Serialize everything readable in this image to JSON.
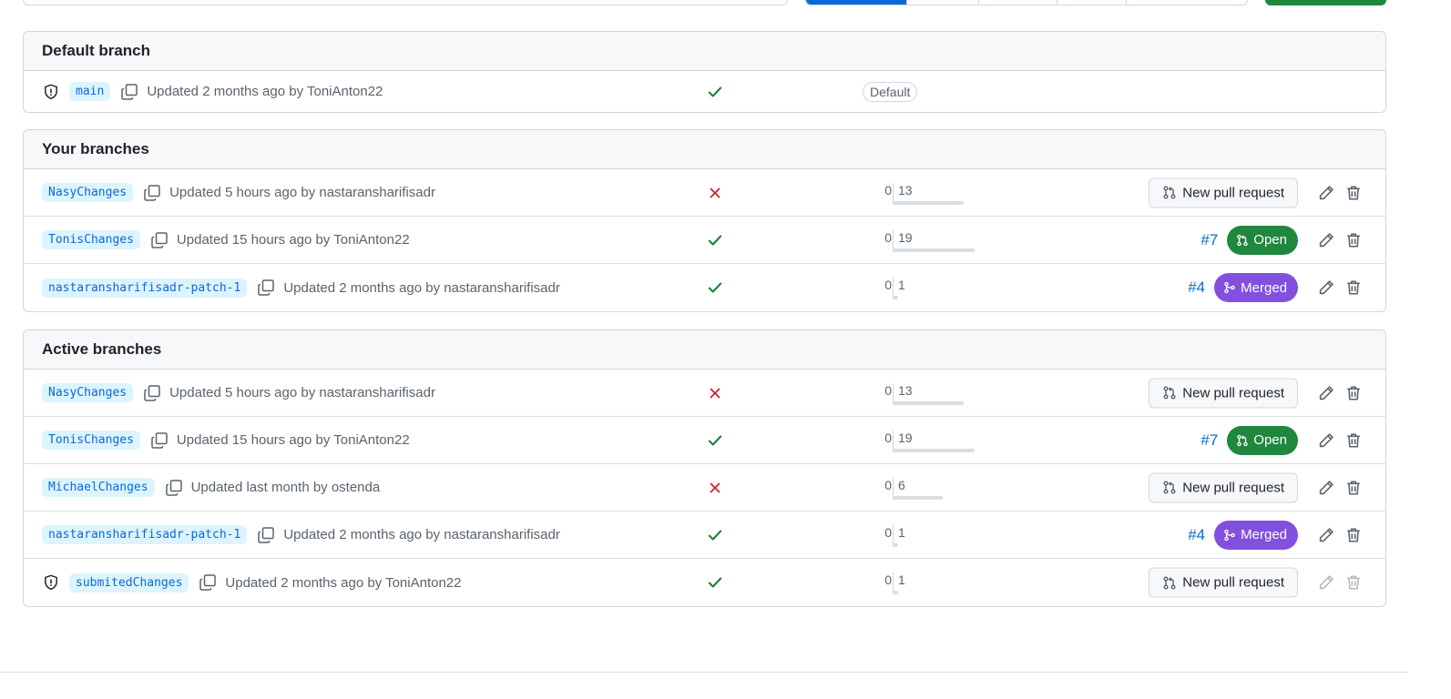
{
  "colors": {
    "success": "#1a7f37",
    "danger": "#cf222e",
    "link": "#0969da",
    "open": "#1f883d",
    "merged": "#8250df"
  },
  "default_section": {
    "title": "Default branch",
    "rows": [
      {
        "name": "main",
        "protected": true,
        "updated": "Updated 2 months ago by ToniAnton22",
        "status": "success",
        "badge": "Default"
      }
    ]
  },
  "your_section": {
    "title": "Your branches",
    "rows": [
      {
        "name": "NasyChanges",
        "updated": "Updated 5 hours ago by nastaransharifisadr",
        "status": "failure",
        "behind": "0",
        "ahead": "13",
        "pr_button": "New pull request"
      },
      {
        "name": "TonisChanges",
        "updated": "Updated 15 hours ago by ToniAnton22",
        "status": "success",
        "behind": "0",
        "ahead": "19",
        "pr_number": "#7",
        "pr_state": "Open"
      },
      {
        "name": "nastaransharifisadr-patch-1",
        "updated": "Updated 2 months ago by nastaransharifisadr",
        "status": "success",
        "behind": "0",
        "ahead": "1",
        "pr_number": "#4",
        "pr_state": "Merged"
      }
    ]
  },
  "active_section": {
    "title": "Active branches",
    "rows": [
      {
        "name": "NasyChanges",
        "updated": "Updated 5 hours ago by nastaransharifisadr",
        "status": "failure",
        "behind": "0",
        "ahead": "13",
        "pr_button": "New pull request"
      },
      {
        "name": "TonisChanges",
        "updated": "Updated 15 hours ago by ToniAnton22",
        "status": "success",
        "behind": "0",
        "ahead": "19",
        "pr_number": "#7",
        "pr_state": "Open"
      },
      {
        "name": "MichaelChanges",
        "updated": "Updated last month by ostenda",
        "status": "failure",
        "behind": "0",
        "ahead": "6",
        "pr_button": "New pull request"
      },
      {
        "name": "nastaransharifisadr-patch-1",
        "updated": "Updated 2 months ago by nastaransharifisadr",
        "status": "success",
        "behind": "0",
        "ahead": "1",
        "pr_number": "#4",
        "pr_state": "Merged"
      },
      {
        "name": "submitedChanges",
        "protected": true,
        "updated": "Updated 2 months ago by ToniAnton22",
        "status": "success",
        "behind": "0",
        "ahead": "1",
        "pr_button": "New pull request"
      }
    ]
  }
}
